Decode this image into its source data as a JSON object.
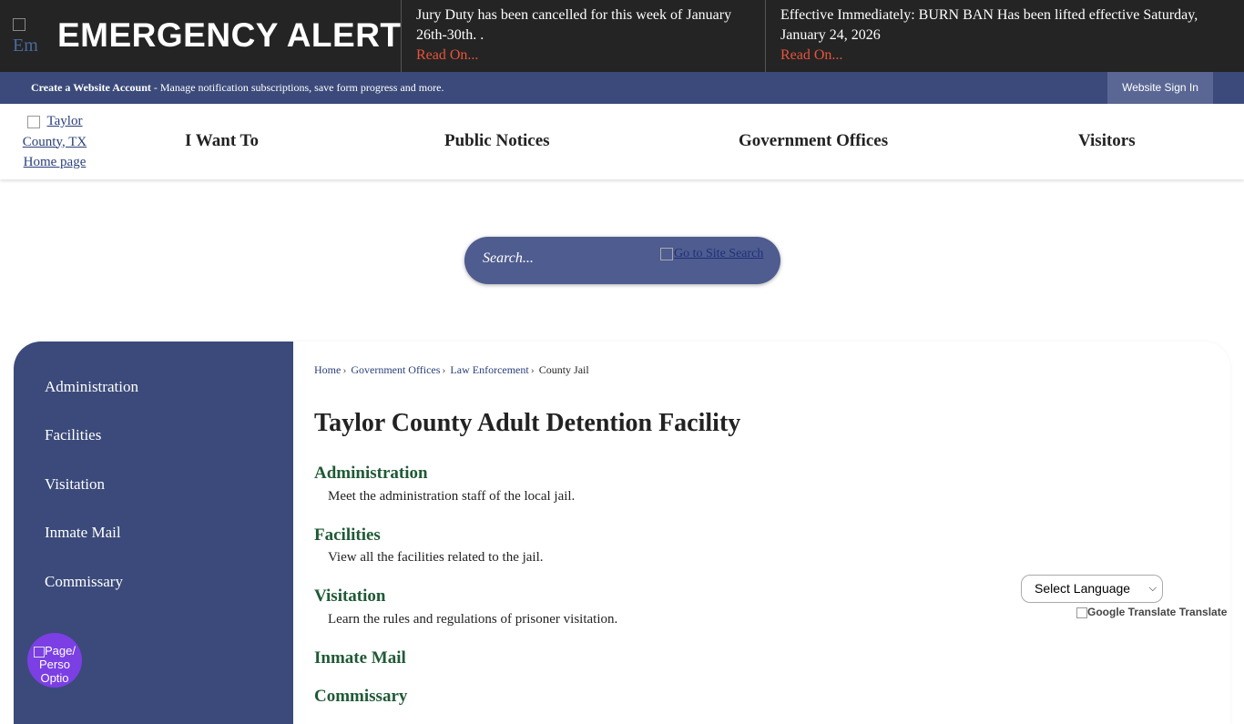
{
  "alert": {
    "title": "EMERGENCY ALERT",
    "logo_alt": "Em",
    "items": [
      {
        "text": "Jury Duty has been cancelled for this week of January 26th-30th. .",
        "link": "Read On..."
      },
      {
        "text": "Effective Immediately: BURN BAN Has been lifted effective Saturday, January 24, 2026",
        "link": "Read On..."
      }
    ]
  },
  "account": {
    "create_label": "Create a Website Account",
    "create_desc": " - Manage notification subscriptions, save form progress and more.",
    "signin_label": "Website Sign In"
  },
  "header": {
    "home_link": "Taylor County, TX Home page",
    "nav": [
      "I Want To",
      "Public Notices",
      "Government Offices",
      "Visitors"
    ]
  },
  "search": {
    "placeholder": "Search...",
    "go_label": "Go to Site Search"
  },
  "sidebar": {
    "items": [
      "Administration",
      "Facilities",
      "Visitation",
      "Inmate Mail",
      "Commissary"
    ]
  },
  "breadcrumb": [
    "Home",
    "Government Offices",
    "Law Enforcement",
    "County Jail"
  ],
  "main": {
    "title": "Taylor County Adult Detention Facility",
    "sections": [
      {
        "title": "Administration",
        "desc": "Meet the administration staff of the local jail."
      },
      {
        "title": "Facilities",
        "desc": "View all the facilities related to the jail."
      },
      {
        "title": "Visitation",
        "desc": "Learn the rules and regulations of prisoner visitation."
      },
      {
        "title": "Inmate Mail",
        "desc": ""
      },
      {
        "title": "Commissary",
        "desc": ""
      }
    ]
  },
  "translate": {
    "select_label": "Select Language",
    "powered": "Google Translate Translate"
  },
  "page_options": {
    "label": "Page/ Perso Optio"
  },
  "colors": {
    "alert_bg": "#242424",
    "brand_navy": "#3b4a7a",
    "link_red": "#e8533b",
    "section_green": "#1f5a35",
    "page_options_purple": "#7b3fe4"
  }
}
